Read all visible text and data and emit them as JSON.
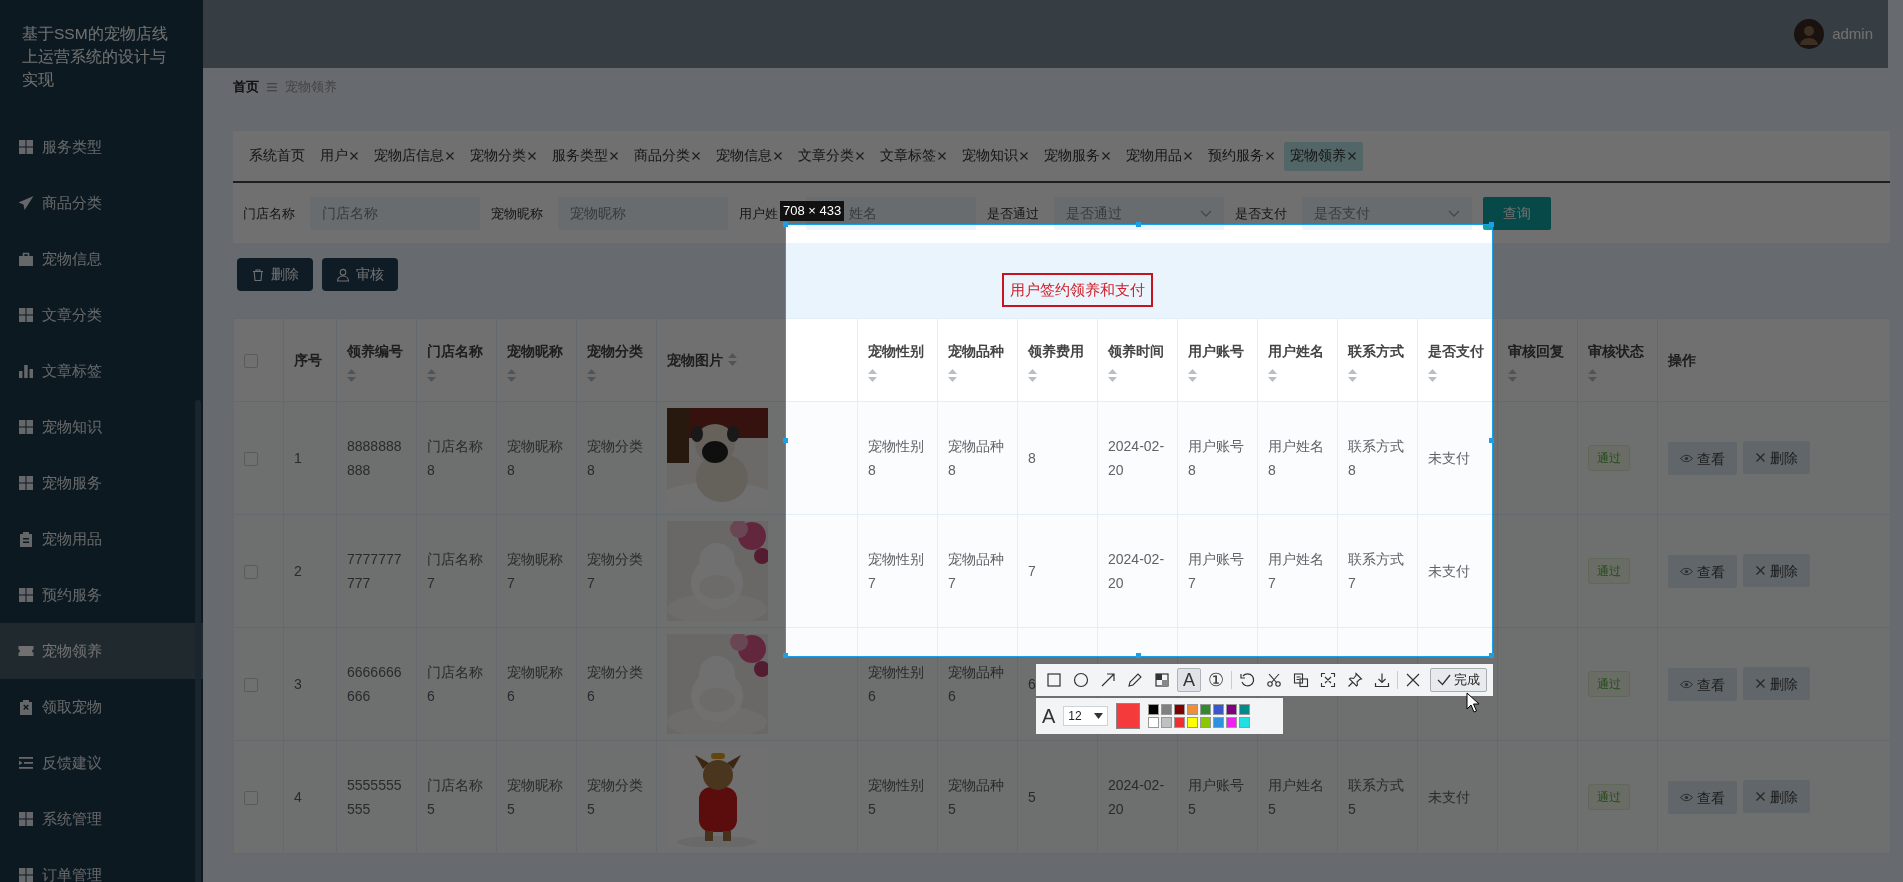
{
  "sidebar": {
    "title": "基于SSM的宠物店线上运营系统的设计与实现",
    "items": [
      {
        "label": "服务类型",
        "kind": "grid",
        "selected": false
      },
      {
        "label": "商品分类",
        "kind": "plane",
        "selected": false
      },
      {
        "label": "宠物信息",
        "kind": "briefcase",
        "selected": false
      },
      {
        "label": "文章分类",
        "kind": "grid",
        "selected": false
      },
      {
        "label": "文章标签",
        "kind": "chart",
        "selected": false
      },
      {
        "label": "宠物知识",
        "kind": "grid",
        "selected": false
      },
      {
        "label": "宠物服务",
        "kind": "grid",
        "selected": false
      },
      {
        "label": "宠物用品",
        "kind": "clipboard",
        "selected": false
      },
      {
        "label": "预约服务",
        "kind": "grid",
        "selected": false
      },
      {
        "label": "宠物领养",
        "kind": "ticket",
        "selected": true
      },
      {
        "label": "领取宠物",
        "kind": "clipboardx",
        "selected": false
      },
      {
        "label": "反馈建议",
        "kind": "indent",
        "selected": false
      },
      {
        "label": "系统管理",
        "kind": "grid",
        "selected": false
      },
      {
        "label": "订单管理",
        "kind": "grid",
        "selected": false
      }
    ]
  },
  "header": {
    "user": "admin"
  },
  "breadcrumb": {
    "home": "首页",
    "current": "宠物领养"
  },
  "tabs": [
    {
      "label": "系统首页",
      "closable": false,
      "selected": false
    },
    {
      "label": "用户",
      "closable": true,
      "selected": false
    },
    {
      "label": "宠物店信息",
      "closable": true,
      "selected": false
    },
    {
      "label": "宠物分类",
      "closable": true,
      "selected": false
    },
    {
      "label": "服务类型",
      "closable": true,
      "selected": false
    },
    {
      "label": "商品分类",
      "closable": true,
      "selected": false
    },
    {
      "label": "宠物信息",
      "closable": true,
      "selected": false
    },
    {
      "label": "文章分类",
      "closable": true,
      "selected": false
    },
    {
      "label": "文章标签",
      "closable": true,
      "selected": false
    },
    {
      "label": "宠物知识",
      "closable": true,
      "selected": false
    },
    {
      "label": "宠物服务",
      "closable": true,
      "selected": false
    },
    {
      "label": "宠物用品",
      "closable": true,
      "selected": false
    },
    {
      "label": "预约服务",
      "closable": true,
      "selected": false
    },
    {
      "label": "宠物领养",
      "closable": true,
      "selected": true
    }
  ],
  "filters": [
    {
      "label": "门店名称",
      "placeholder": "门店名称",
      "kind": "input"
    },
    {
      "label": "宠物昵称",
      "placeholder": "宠物昵称",
      "kind": "input"
    },
    {
      "label": "用户姓",
      "placeholder": "姓名",
      "kind": "input"
    },
    {
      "label": "是否通过",
      "placeholder": "是否通过",
      "kind": "select"
    },
    {
      "label": "是否支付",
      "placeholder": "是否支付",
      "kind": "select"
    }
  ],
  "search_button": "查询",
  "actions": [
    {
      "label": "删除",
      "kind": "trash"
    },
    {
      "label": "审核",
      "kind": "user"
    }
  ],
  "table": {
    "header_checked": false,
    "columns": [
      {
        "label": "序号",
        "kind": "plain"
      },
      {
        "label": "领养编号",
        "kind": "sortable"
      },
      {
        "label": "门店名称",
        "kind": "sortable"
      },
      {
        "label": "宠物昵称",
        "kind": "sortable"
      },
      {
        "label": "宠物分类",
        "kind": "sortable"
      },
      {
        "label": "宠物图片",
        "kind": "inline"
      },
      {
        "label": "宠物性别",
        "kind": "sortable"
      },
      {
        "label": "宠物品种",
        "kind": "sortable"
      },
      {
        "label": "领养费用",
        "kind": "sortable"
      },
      {
        "label": "领养时间",
        "kind": "sortable"
      },
      {
        "label": "用户账号",
        "kind": "sortable"
      },
      {
        "label": "用户姓名",
        "kind": "sortable"
      },
      {
        "label": "联系方式",
        "kind": "sortable"
      },
      {
        "label": "是否支付",
        "kind": "sortable"
      },
      {
        "label": "审核回复",
        "kind": "sortable"
      },
      {
        "label": "审核状态",
        "kind": "sortable"
      },
      {
        "label": "操作",
        "kind": "plain"
      }
    ],
    "rows": [
      {
        "checked": false,
        "cells": [
          "1",
          "8888888888",
          "门店名称8",
          "宠物昵称8",
          "宠物分类8",
          {
            "kind": "picture"
          },
          "宠物性别8",
          "宠物品种8",
          "8",
          "2024-02-20",
          "用户账号8",
          "用户姓名8",
          "联系方式8",
          "未支付",
          null,
          {
            "kind": "status",
            "text": "通过"
          },
          {
            "kind": "actions",
            "buttons": [
              "查看",
              "删除"
            ]
          }
        ]
      },
      {
        "checked": false,
        "cells": [
          "2",
          "7777777777",
          "门店名称7",
          "宠物昵称7",
          "宠物分类7",
          {
            "kind": "picture"
          },
          "宠物性别7",
          "宠物品种7",
          "7",
          "2024-02-20",
          "用户账号7",
          "用户姓名7",
          "联系方式7",
          "未支付",
          null,
          {
            "kind": "status",
            "text": "通过"
          },
          {
            "kind": "actions",
            "buttons": [
              "查看",
              "删除"
            ]
          }
        ]
      },
      {
        "checked": false,
        "cells": [
          "3",
          "6666666666",
          "门店名称6",
          "宠物昵称6",
          "宠物分类6",
          {
            "kind": "picture"
          },
          "宠物性别6",
          "宠物品种6",
          "6",
          null,
          null,
          null,
          null,
          null,
          null,
          {
            "kind": "status",
            "text": "通过"
          },
          {
            "kind": "actions",
            "buttons": [
              "查看",
              "删除"
            ]
          }
        ]
      },
      {
        "checked": false,
        "cells": [
          "4",
          "5555555555",
          "门店名称5",
          "宠物昵称5",
          "宠物分类5",
          {
            "kind": "picture"
          },
          "宠物性别5",
          "宠物品种5",
          "5",
          "2024-02-20",
          "用户账号5",
          "用户姓名5",
          "联系方式5",
          "未支付",
          null,
          {
            "kind": "status",
            "text": "通过"
          },
          {
            "kind": "actions",
            "buttons": [
              "查看",
              "删除"
            ]
          }
        ]
      }
    ]
  },
  "screenshot_tool": {
    "size_label": "708 × 433",
    "annotation": "用户签约领养和支付",
    "tool_groups": [
      [
        {
          "kind": "rect",
          "selected": false
        },
        {
          "kind": "circle",
          "selected": false
        },
        {
          "kind": "arrow",
          "selected": false
        },
        {
          "kind": "pencil",
          "selected": false
        },
        {
          "kind": "mosaic",
          "selected": false
        },
        {
          "kind": "text",
          "glyph": "A",
          "selected": true
        },
        {
          "kind": "number",
          "glyph": "①",
          "selected": false
        }
      ],
      [
        {
          "kind": "undo",
          "selected": false
        },
        {
          "kind": "scissors",
          "selected": false
        },
        {
          "kind": "document",
          "selected": false
        },
        {
          "kind": "scan",
          "selected": false
        },
        {
          "kind": "pin",
          "selected": false
        },
        {
          "kind": "download",
          "selected": false
        }
      ],
      [
        {
          "kind": "close",
          "selected": false
        }
      ]
    ],
    "done": "完成",
    "font_glyph": "A",
    "font_size": "12",
    "current": {
      "color": "#f43a3a"
    },
    "palette": [
      {
        "color": "#000000"
      },
      {
        "color": "#808080"
      },
      {
        "color": "#800000"
      },
      {
        "color": "#f08c3a"
      },
      {
        "color": "#2e8b2e"
      },
      {
        "color": "#3a55d0"
      },
      {
        "color": "#800080"
      },
      {
        "color": "#008b8b"
      },
      {
        "color": "#ffffff"
      },
      {
        "color": "#c0c0c0"
      },
      {
        "color": "#f03030"
      },
      {
        "color": "#ffff00"
      },
      {
        "color": "#8cc800"
      },
      {
        "color": "#3090e0"
      },
      {
        "color": "#f020f0"
      },
      {
        "color": "#20e0e0"
      }
    ]
  }
}
